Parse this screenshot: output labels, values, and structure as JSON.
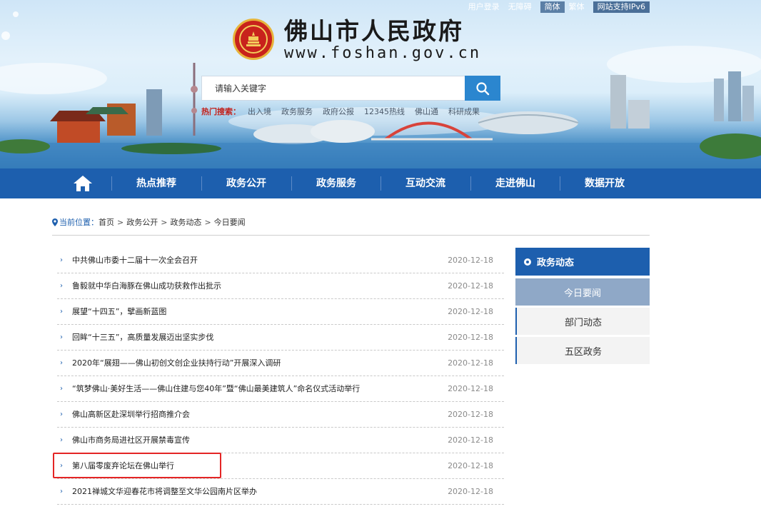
{
  "toplinks": [
    "用户登录",
    "无障碍",
    "简体",
    "繁体",
    "网站支持IPv6"
  ],
  "site": {
    "title": "佛山市人民政府",
    "url": "www.foshan.gov.cn"
  },
  "search": {
    "placeholder": "请输入关键字"
  },
  "hot": {
    "label": "热门搜索：",
    "items": [
      "出入境",
      "政务服务",
      "政府公报",
      "12345热线",
      "佛山通",
      "科研成果"
    ]
  },
  "nav": {
    "items": [
      "热点推荐",
      "政务公开",
      "政务服务",
      "互动交流",
      "走进佛山",
      "数据开放"
    ]
  },
  "breadcrumb": {
    "label": "当前位置：",
    "items": [
      "首页",
      "政务公开",
      "政务动态",
      "今日要闻"
    ]
  },
  "news": [
    {
      "title": "中共佛山市委十二届十一次全会召开",
      "date": "2020-12-18"
    },
    {
      "title": "鲁毅就中华白海豚在佛山成功获救作出批示",
      "date": "2020-12-18"
    },
    {
      "title": "展望“十四五”，擘画新蓝图",
      "date": "2020-12-18"
    },
    {
      "title": "回眸“十三五”，高质量发展迈出坚实步伐",
      "date": "2020-12-18"
    },
    {
      "title": "2020年“展翅——佛山初创文创企业扶持行动”开展深入调研",
      "date": "2020-12-18"
    },
    {
      "title": "“筑梦佛山·美好生活——佛山住建与您40年”暨“佛山最美建筑人”命名仪式活动举行",
      "date": "2020-12-18"
    },
    {
      "title": "佛山高新区赴深圳举行招商推介会",
      "date": "2020-12-18"
    },
    {
      "title": "佛山市商务局进社区开展禁毒宣传",
      "date": "2020-12-18"
    },
    {
      "title": "第八届零废弃论坛在佛山举行",
      "date": "2020-12-18"
    },
    {
      "title": "2021禅城文华迎春花市将调整至文华公园南片区举办",
      "date": "2020-12-18"
    }
  ],
  "sidebar": {
    "heading": "政务动态",
    "items": [
      "今日要闻",
      "部门动态",
      "五区政务"
    ]
  },
  "colors": {
    "nav": "#1d5fae",
    "search_button": "#2b86cf",
    "hot_label": "#c2201a",
    "highlight_box": "#e42525",
    "sidebar_active": "#8fa8c7"
  }
}
